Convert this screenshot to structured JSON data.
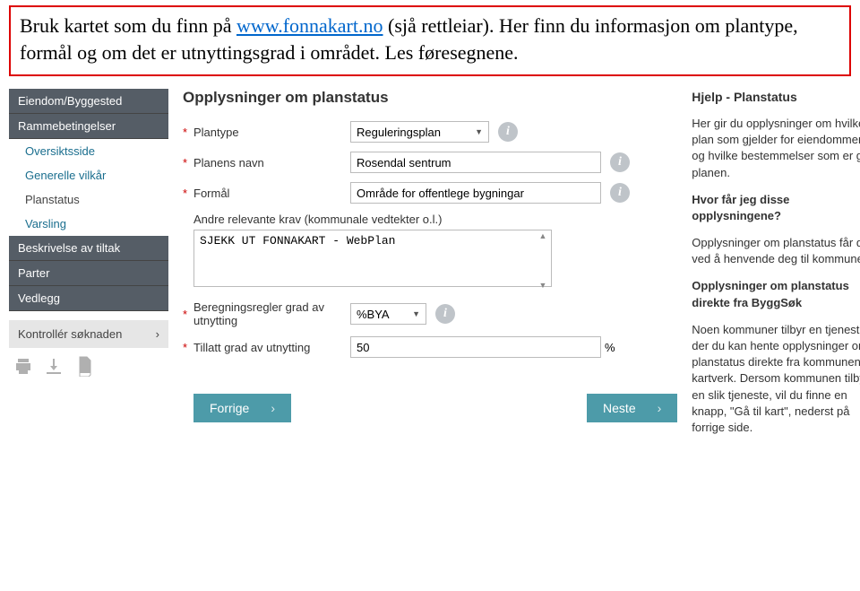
{
  "banner": {
    "pre": "Bruk kartet som du finn på ",
    "link_text": "www.fonnakart.no",
    "post": " (sjå rettleiar). Her finn du informasjon om plantype, formål og om det er utnyttingsgrad i området.  Les føresegnene."
  },
  "sidebar": {
    "items": [
      {
        "label": "Eiendom/Byggested",
        "type": "hdr"
      },
      {
        "label": "Rammebetingelser",
        "type": "hdr"
      },
      {
        "label": "Oversiktsside",
        "type": "sub"
      },
      {
        "label": "Generelle vilkår",
        "type": "sub"
      },
      {
        "label": "Planstatus",
        "type": "sub-active"
      },
      {
        "label": "Varsling",
        "type": "sub"
      },
      {
        "label": "Beskrivelse av tiltak",
        "type": "hdr"
      },
      {
        "label": "Parter",
        "type": "hdr"
      },
      {
        "label": "Vedlegg",
        "type": "hdr"
      }
    ],
    "kontroller": "Kontrollér søknaden"
  },
  "main": {
    "title": "Opplysninger om planstatus",
    "plantype_label": "Plantype",
    "plantype_value": "Reguleringsplan",
    "planens_navn_label": "Planens navn",
    "planens_navn_value": "Rosendal sentrum",
    "formaal_label": "Formål",
    "formaal_value": "Område for offentlege bygningar",
    "andre_label": "Andre relevante krav (kommunale vedtekter o.l.)",
    "andre_value": "SJEKK UT FONNAKART - WebPlan",
    "beregning_label": "Beregningsregler grad av utnytting",
    "beregning_value": "%BYA",
    "tillatt_label": "Tillatt grad av utnytting",
    "tillatt_value": "50",
    "pct": "%",
    "forrige": "Forrige",
    "neste": "Neste"
  },
  "help": {
    "title": "Hjelp - Planstatus",
    "p1": "Her gir du opplysninger om hvilke plan som gjelder for eiendommen, og hvilke bestemmelser som er gitt i planen.",
    "h2": "Hvor får jeg disse opplysningene?",
    "p2": "Opplysninger om planstatus får du ved å henvende deg til kommunen.",
    "h3": "Opplysninger om planstatus direkte fra ByggSøk",
    "p3": "Noen kommuner tilbyr en tjeneste der du kan hente opplysninger om planstatus direkte fra kommunens kartverk. Dersom kommunen tilbyr en slik tjeneste, vil du finne en knapp, \"Gå til kart\", nederst på forrige side."
  }
}
